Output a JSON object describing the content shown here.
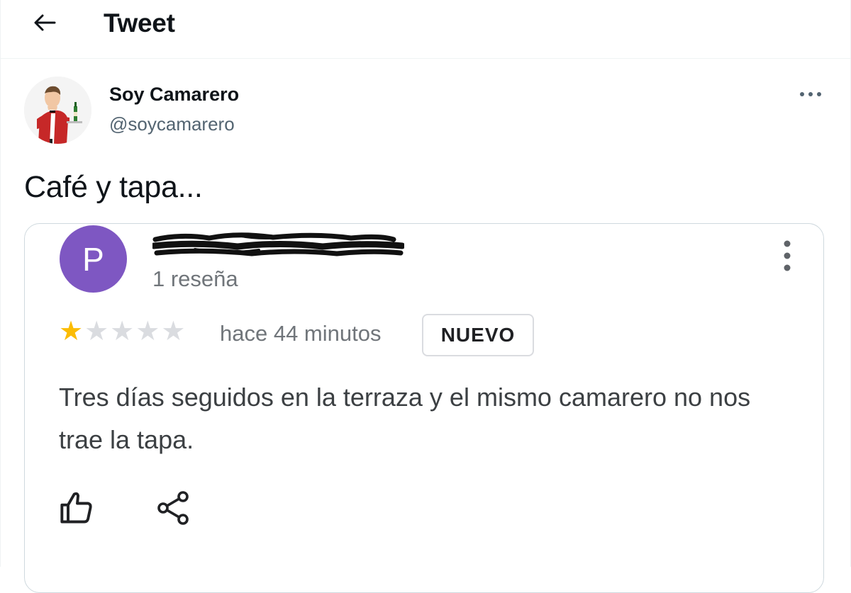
{
  "header": {
    "title": "Tweet",
    "back_icon": "arrow-left-icon"
  },
  "author": {
    "name": "Soy Camarero",
    "handle": "@soycamarero",
    "more_icon": "more-horizontal-icon"
  },
  "tweet": {
    "text": "Café y tapa..."
  },
  "review": {
    "avatar_letter": "P",
    "avatar_color": "#7e57c2",
    "review_count": "1 reseña",
    "rating": 1,
    "max_rating": 5,
    "star_filled_color": "#fbbc04",
    "star_empty_color": "#dadce0",
    "time": "hace 44 minutos",
    "badge": "NUEVO",
    "text": "Tres días seguidos en la terraza y el mismo camarero no nos trae la tapa.",
    "like_icon": "thumbs-up-icon",
    "share_icon": "share-icon",
    "menu_icon": "more-vertical-icon"
  }
}
